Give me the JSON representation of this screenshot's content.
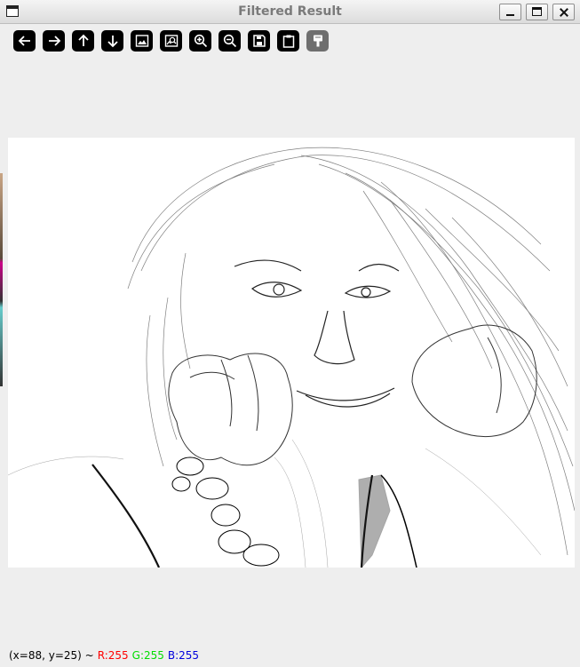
{
  "window": {
    "title": "Filtered Result"
  },
  "toolbar": {
    "buttons": [
      {
        "name": "pan-left-icon"
      },
      {
        "name": "pan-right-icon"
      },
      {
        "name": "pan-up-icon"
      },
      {
        "name": "pan-down-icon"
      },
      {
        "name": "zoom-fit-icon"
      },
      {
        "name": "zoom-original-icon"
      },
      {
        "name": "zoom-in-icon"
      },
      {
        "name": "zoom-out-icon"
      },
      {
        "name": "save-image-icon"
      },
      {
        "name": "copy-to-clipboard-icon"
      },
      {
        "name": "properties-icon"
      }
    ]
  },
  "status": {
    "coords": "(x=88, y=25) ~",
    "r": "R:255",
    "g": "G:255",
    "b": "B:255",
    "colors": {
      "r": "#ff0000",
      "g": "#00dd00",
      "b": "#0000dd"
    }
  }
}
